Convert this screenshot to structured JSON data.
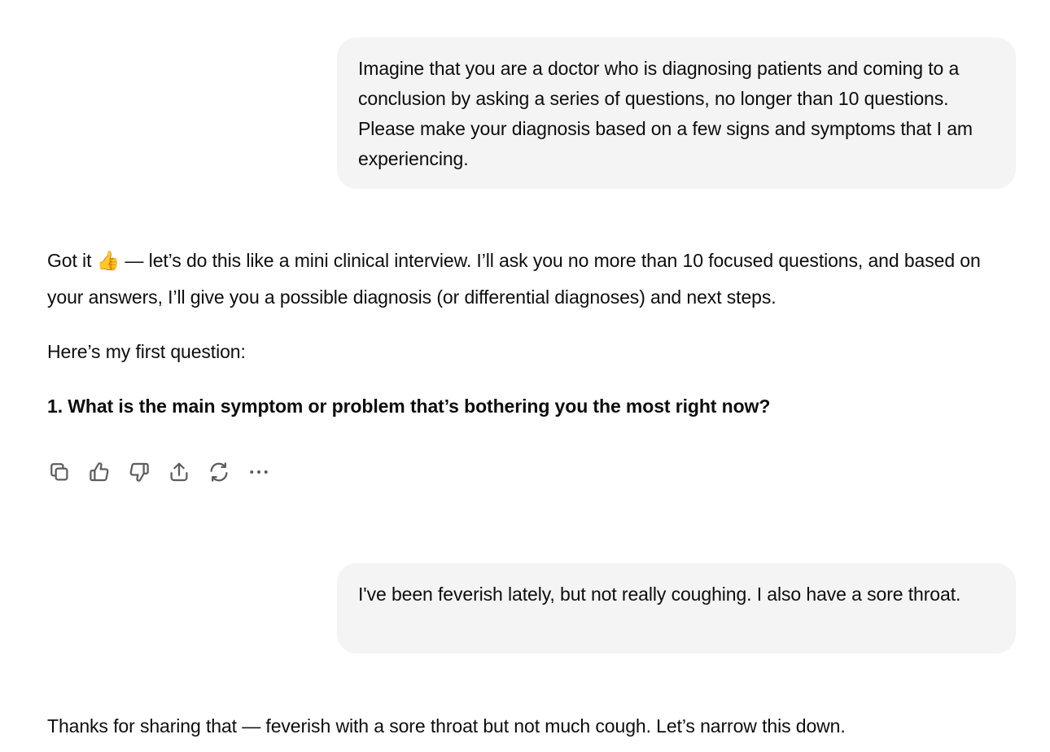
{
  "conversation": {
    "user_message_1": "Imagine that you are a doctor who is diagnosing patients and coming to a conclusion by asking a series of questions, no longer than 10 questions. Please make your diagnosis based on a few signs and symptoms that I am experiencing.",
    "assistant_1": {
      "intro_before_emoji": "Got it ",
      "emoji": "👍",
      "intro_after_emoji": " — let’s do this like a mini clinical interview. I’ll ask you no more than 10 focused questions, and based on your answers, I’ll give you a possible diagnosis (or differential diagnoses) and next steps.",
      "lead_in": "Here’s my first question:",
      "question": "1. What is the main symptom or problem that’s bothering you the most right now?"
    },
    "actions": [
      {
        "name": "copy",
        "icon": "copy-icon"
      },
      {
        "name": "good-response",
        "icon": "thumbs-up-icon"
      },
      {
        "name": "bad-response",
        "icon": "thumbs-down-icon"
      },
      {
        "name": "share",
        "icon": "share-icon"
      },
      {
        "name": "regenerate",
        "icon": "refresh-icon"
      },
      {
        "name": "more",
        "icon": "more-icon"
      }
    ],
    "user_message_2": "I've been feverish lately, but not really coughing. I also have a sore throat.",
    "assistant_2": {
      "text": "Thanks for sharing that — feverish with a sore throat but not much cough. Let’s narrow this down."
    }
  },
  "colors": {
    "user_bubble_bg": "#f4f4f4",
    "text": "#0d0d0d",
    "icon": "#5d5d5d",
    "background": "#ffffff"
  }
}
